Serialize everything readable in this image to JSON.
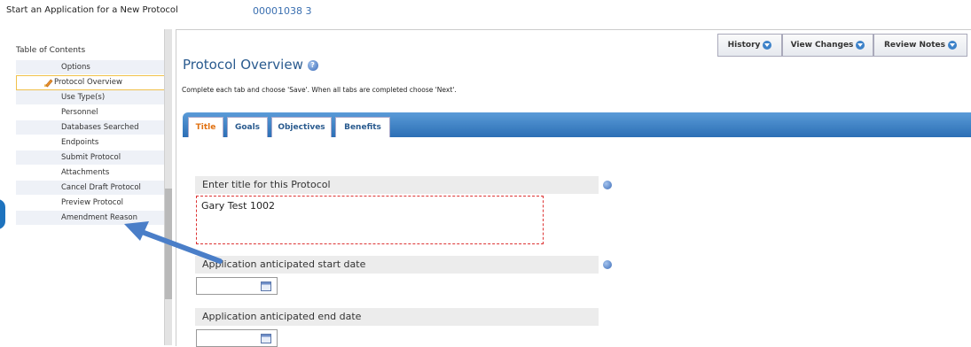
{
  "app": {
    "title": "Start an Application for a New Protocol",
    "protocol_id": "00001038 3"
  },
  "sidebar": {
    "title": "Table of Contents",
    "items": [
      {
        "label": "Options",
        "active": false
      },
      {
        "label": "Protocol Overview",
        "active": true
      },
      {
        "label": "Use Type(s)",
        "active": false
      },
      {
        "label": "Personnel",
        "active": false
      },
      {
        "label": "Databases Searched",
        "active": false
      },
      {
        "label": "Endpoints",
        "active": false
      },
      {
        "label": "Submit Protocol",
        "active": false
      },
      {
        "label": "Attachments",
        "active": false
      },
      {
        "label": "Cancel Draft Protocol",
        "active": false
      },
      {
        "label": "Preview Protocol",
        "active": false
      },
      {
        "label": "Amendment Reason",
        "active": false
      }
    ]
  },
  "header_buttons": [
    {
      "label": "History"
    },
    {
      "label": "View Changes"
    },
    {
      "label": "Review Notes"
    }
  ],
  "main": {
    "title": "Protocol Overview",
    "instruction": "Complete each tab and choose 'Save'.  When all tabs are completed choose 'Next'.",
    "tabs": [
      {
        "label": "Title",
        "active": true
      },
      {
        "label": "Goals",
        "active": false
      },
      {
        "label": "Objectives",
        "active": false
      },
      {
        "label": "Benefits",
        "active": false
      }
    ],
    "fields": {
      "title_label": "Enter title for this Protocol",
      "title_value": "Gary Test 1002",
      "start_label": "Application anticipated start date",
      "start_value": "",
      "end_label": "Application anticipated end date",
      "end_value": ""
    }
  },
  "colors": {
    "accent": "#2c6fb5",
    "active_tab_text": "#e07010",
    "required_border": "#dd3333",
    "annotation_arrow": "#4a7ec8"
  },
  "icons": [
    "help-icon",
    "pencil-icon",
    "calendar-icon",
    "chevron-down-icon"
  ]
}
